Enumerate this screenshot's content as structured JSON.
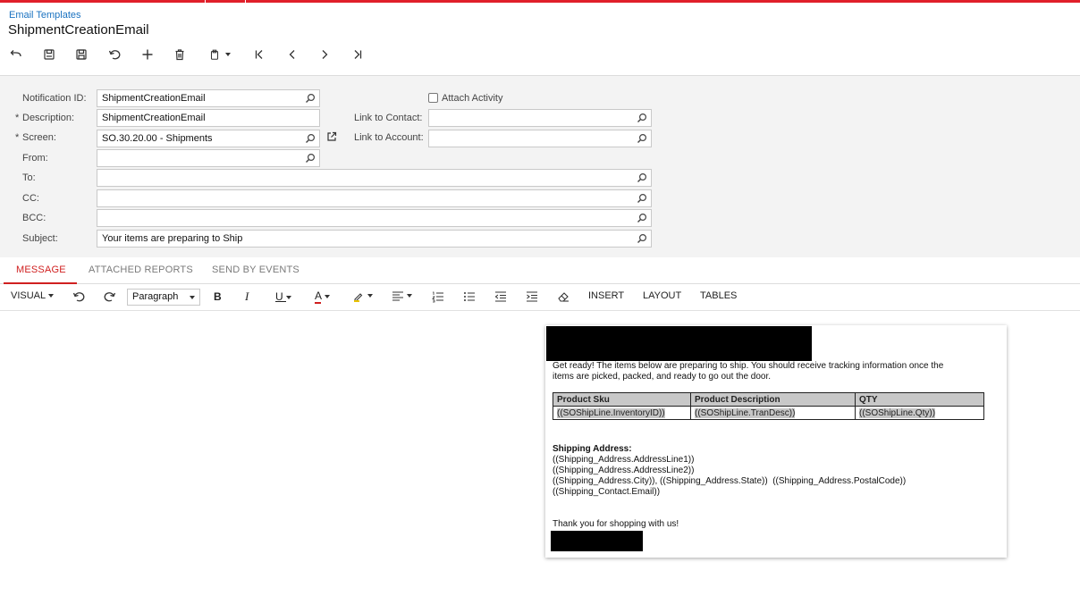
{
  "breadcrumb": "Email Templates",
  "title": "ShipmentCreationEmail",
  "toolbar": {
    "icons": [
      "back-icon",
      "save-close-icon",
      "save-icon",
      "undo-icon",
      "add-icon",
      "delete-icon",
      "copy-paste-icon",
      "first-record-icon",
      "previous-record-icon",
      "next-record-icon",
      "last-record-icon"
    ]
  },
  "form": {
    "notification_id": {
      "label": "Notification ID:",
      "value": "ShipmentCreationEmail"
    },
    "description": {
      "label": "Description:",
      "value": "ShipmentCreationEmail",
      "required": "*"
    },
    "screen": {
      "label": "Screen:",
      "value": "SO.30.20.00 - Shipments",
      "required": "*"
    },
    "from": {
      "label": "From:",
      "value": ""
    },
    "to": {
      "label": "To:",
      "value": ""
    },
    "cc": {
      "label": "CC:",
      "value": ""
    },
    "bcc": {
      "label": "BCC:",
      "value": ""
    },
    "subject": {
      "label": "Subject:",
      "value": "Your items are preparing to Ship"
    },
    "attach_activity": {
      "label": "Attach Activity",
      "checked": false
    },
    "link_to_contact": {
      "label": "Link to Contact:",
      "value": ""
    },
    "link_to_account": {
      "label": "Link to Account:",
      "value": ""
    }
  },
  "tabs": [
    {
      "label": "MESSAGE",
      "active": true
    },
    {
      "label": "ATTACHED REPORTS",
      "active": false
    },
    {
      "label": "SEND BY EVENTS",
      "active": false
    }
  ],
  "editor_toolbar": {
    "mode": "VISUAL",
    "paragraph": "Paragraph",
    "insert": "INSERT",
    "layout": "LAYOUT",
    "tables": "TABLES"
  },
  "email": {
    "intro_line1": "Get ready! The items below are preparing to ship. You should receive tracking information once the",
    "intro_line2": "items are picked, packed, and ready to go out the door.",
    "table": {
      "headers": [
        "Product Sku",
        "Product Description",
        "QTY"
      ],
      "row": [
        "((SOShipLine.InventoryID))",
        "((SOShipLine.TranDesc))",
        "((SOShipLine.Qty))"
      ]
    },
    "shipping_heading": "Shipping Address:",
    "address_line1": "((Shipping_Address.AddressLine1))",
    "address_line2": "((Shipping_Address.AddressLine2))",
    "address_line3": "((Shipping_Address.City)), ((Shipping_Address.State))  ((Shipping_Address.PostalCode))",
    "address_line4": "((Shipping_Contact.Email))",
    "thanks": "Thank you for shopping with us!"
  },
  "colors": {
    "accent": "#e0202a",
    "link": "#1a72c0",
    "form_bg": "#f3f3f3"
  }
}
